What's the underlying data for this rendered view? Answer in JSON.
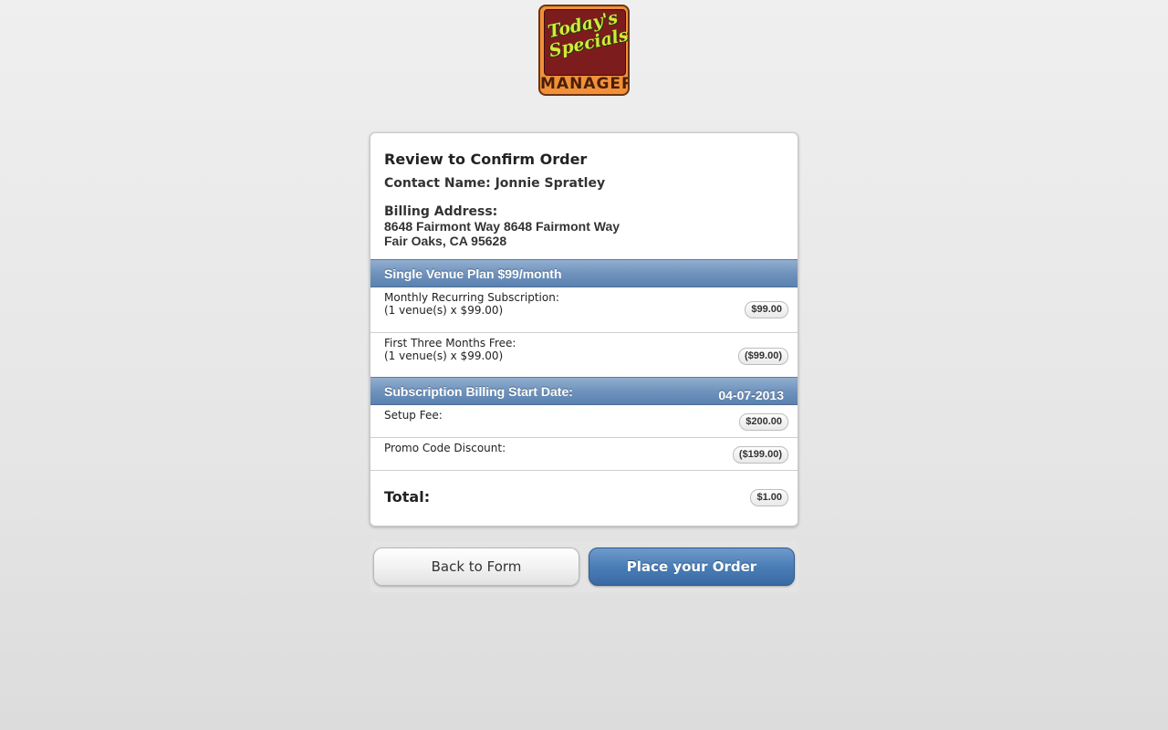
{
  "logo": {
    "script_line1": "Today's",
    "script_line2": "Specials",
    "wordmark": "MANAGER"
  },
  "review": {
    "title": "Review to Confirm Order",
    "contact": "Contact Name: Jonnie Spratley",
    "billing_label": "Billing Address:",
    "address_line1": "8648 Fairmont Way 8648 Fairmont Way",
    "address_line2": "Fair Oaks, CA 95628"
  },
  "plan": {
    "header": "Single Venue Plan $99/month",
    "items": [
      {
        "label": "Monthly Recurring Subscription:",
        "detail": "(1 venue(s) x $99.00)",
        "amount": "$99.00"
      },
      {
        "label": "First Three Months Free:",
        "detail": "(1 venue(s) x $99.00)",
        "amount": "($99.00)"
      }
    ]
  },
  "billing_start": {
    "label": "Subscription Billing Start Date:",
    "date": "04-07-2013"
  },
  "fees": [
    {
      "label": "Setup Fee:",
      "amount": "$200.00"
    },
    {
      "label": "Promo Code Discount:",
      "amount": "($199.00)"
    }
  ],
  "total": {
    "label": "Total:",
    "amount": "$1.00"
  },
  "actions": {
    "back_label": "Back to Form",
    "place_label": "Place your Order"
  },
  "colors": {
    "accent": "#4a7db6",
    "band": "#6f93bd",
    "logo_orange": "#f0913a",
    "logo_red": "#7c1c1c"
  }
}
